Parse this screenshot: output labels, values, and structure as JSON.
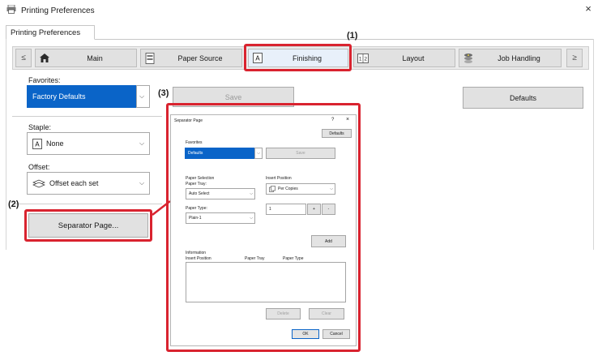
{
  "window": {
    "title": "Printing Preferences",
    "close": "×"
  },
  "active_tab": "Printing Preferences",
  "subtabs": {
    "left_arrow": "≤",
    "right_arrow": "≥",
    "items": [
      "Main",
      "Paper Source",
      "Finishing",
      "Layout",
      "Job Handling"
    ]
  },
  "favorites": {
    "label": "Favorites:",
    "value": "Factory Defaults",
    "save": "Save",
    "defaults": "Defaults"
  },
  "staple": {
    "label": "Staple:",
    "value": "None"
  },
  "offset": {
    "label": "Offset:",
    "value": "Offset each set"
  },
  "separator_button": "Separator Page...",
  "callouts": {
    "c1": "(1)",
    "c2": "(2)",
    "c3": "(3)"
  },
  "dialog": {
    "title": "Separator Page",
    "help": "?",
    "close": "×",
    "defaults": "Defaults",
    "favorites_label": "Favorites",
    "favorites_value": "Defaults",
    "save": "Save",
    "paper_selection": "Paper Selection",
    "paper_tray_label": "Paper Tray:",
    "paper_tray_value": "Auto Select",
    "paper_type_label": "Paper Type:",
    "paper_type_value": "Plain-1",
    "insert_position": "Insert Position",
    "insert_value": "Per Copies",
    "count_value": "1",
    "plus": "+",
    "minus": "-",
    "add": "Add",
    "information": "Information",
    "col_insert": "Insert Position",
    "col_tray": "Paper Tray",
    "col_type": "Paper Type",
    "delete": "Delete",
    "clear": "Clear",
    "ok": "OK",
    "cancel": "Cancel"
  },
  "colors": {
    "accent_red": "#d9232f",
    "select_blue": "#0a64c8"
  }
}
